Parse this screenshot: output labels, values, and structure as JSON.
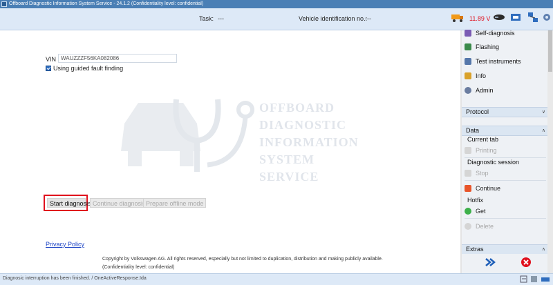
{
  "window": {
    "title": "Offboard Diagnostic Information System Service - 24.1.2 (Confidentiality level: confidential)"
  },
  "topbar": {
    "task_label": "Task:",
    "task_value": "---",
    "vin_label": "Vehicle identification no.:",
    "vin_value": "---",
    "voltage": "11.89 V",
    "voltage_color": "#e0101d"
  },
  "main": {
    "vin_label": "VIN",
    "vin_value": "WAUZZZF56KA082086",
    "guided_label": "Using guided fault finding",
    "guided_checked": true,
    "watermark_lines": [
      "OFFBOARD",
      "DIAGNOSTIC",
      "INFORMATION",
      "SYSTEM",
      "SERVICE"
    ],
    "buttons": {
      "start": "Start diagnosis",
      "continue": "Continue diagnosis",
      "prepare": "Prepare offline mode"
    },
    "privacy_link": "Privacy Policy",
    "copyright_line1": "Copyright by Volkswagen AG. All rights reserved, especially but not limited to duplication, distribution and making publicly available.",
    "copyright_line2": "(Confidentiality level: confidential)"
  },
  "sidebar": {
    "menu": [
      {
        "label": "Self-diagnosis",
        "color": "#7a5bb3"
      },
      {
        "label": "Flashing",
        "color": "#3a8a4a"
      },
      {
        "label": "Test instruments",
        "color": "#5577aa"
      },
      {
        "label": "Info",
        "color": "#d9a12a"
      },
      {
        "label": "Admin",
        "color": "#6b7da0"
      }
    ],
    "protocol_header": "Protocol",
    "data_header": "Data",
    "current_tab_label": "Current tab",
    "printing_label": "Printing",
    "diag_session_label": "Diagnostic session",
    "stop_label": "Stop",
    "continue_label": "Continue",
    "hotfix_label": "Hotfix",
    "get_label": "Get",
    "delete_label": "Delete",
    "extras_header": "Extras"
  },
  "statusbar": {
    "text": "Diagnosic interruption has been finished. / OneActiveResponse.Ida"
  }
}
